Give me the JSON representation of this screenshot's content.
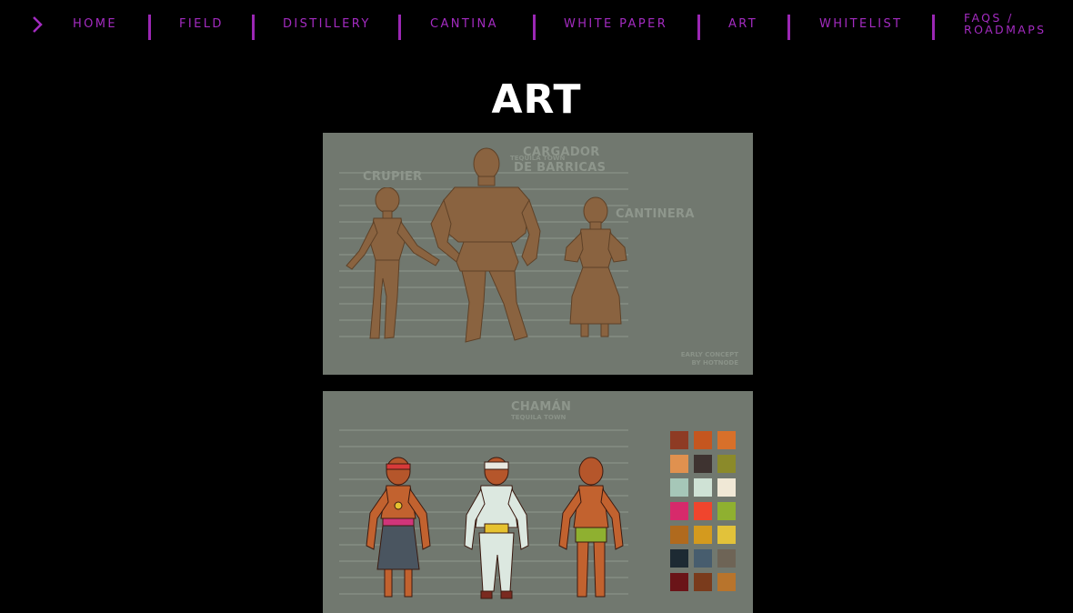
{
  "nav": {
    "items": [
      {
        "label": "HOME"
      },
      {
        "label": "FIELD"
      },
      {
        "label": "DISTILLERY"
      },
      {
        "label": "CANTINA"
      },
      {
        "label": "WHITE PAPER"
      },
      {
        "label": "ART"
      },
      {
        "label": "WHITELIST"
      },
      {
        "line1": "FAQS /",
        "line2": "ROADMAPS"
      }
    ],
    "chevron_icon": "chevron-right-icon"
  },
  "page": {
    "title": "ART"
  },
  "panel1": {
    "labels": {
      "cargador": "CARGADOR",
      "tequila_town": "TEQUILA TOWN",
      "de_barricas": "DE BARRICAS",
      "crupier": "CRUPIER",
      "cantinera": "CANTINERA"
    },
    "credit": {
      "line1": "EARLY CONCEPT",
      "line2": "BY HOTNODE"
    }
  },
  "panel2": {
    "labels": {
      "chaman": "CHAMÁN",
      "tequila_town": "TEQUILA TOWN"
    },
    "palette": [
      "#8e3b24",
      "#c5561f",
      "#d8702a",
      "#e0914f",
      "#3e3330",
      "#8b8a2a",
      "#a6c7b8",
      "#cfe2d5",
      "#f0e8d6",
      "#d72a6b",
      "#f0452d",
      "#8fb030",
      "#b06a1e",
      "#d49a1e",
      "#e2c23a",
      "#1d2a33",
      "#475d6e",
      "#6e6456",
      "#6a1418",
      "#7a3b1c",
      "#b8742c"
    ]
  },
  "colors": {
    "accent": "#a32bc0",
    "background": "#000000",
    "panel": "#71786f",
    "silhouette": "#8a6340"
  }
}
